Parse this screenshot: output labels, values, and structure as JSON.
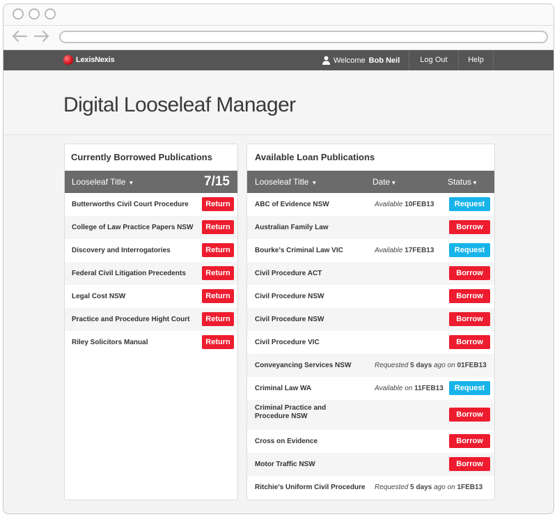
{
  "app": {
    "logo_text": "LexisNexis",
    "welcome_prefix": "Welcome",
    "user_name": "Bob Neil",
    "logout_label": "Log Out",
    "help_label": "Help",
    "page_title": "Digital Looseleaf Manager"
  },
  "colors": {
    "header_bg": "#555555",
    "table_header_bg": "#6b6b6b",
    "return_red": "#ed1c2e",
    "request_blue": "#17b4ea"
  },
  "borrowed": {
    "title": "Currently Borrowed Publications",
    "column_title": "Looseleaf Title",
    "count": "7/15",
    "button_label": "Return",
    "items": [
      "Butterworths Civil Court Procedure",
      "College of Law Practice Papers NSW",
      "Discovery and Interrogatories",
      "Federal Civil Litigation Precedents",
      "Legal Cost NSW",
      "Practice and Procedure Hight Court",
      "Riley Solicitors Manual"
    ]
  },
  "available": {
    "title": "Available Loan Publications",
    "columns": {
      "title": "Looseleaf Title",
      "date": "Date",
      "status": "Status"
    },
    "borrow_label": "Borrow",
    "request_label": "Request",
    "items": [
      {
        "name": "ABC of Evidence NSW",
        "status_pre": "Available",
        "status_mid": "",
        "status_bold": "10FEB13",
        "action": "Request"
      },
      {
        "name": "Australian Family Law",
        "status_pre": "",
        "status_mid": "",
        "status_bold": "",
        "action": "Borrow"
      },
      {
        "name": "Bourke's Criminal Law VIC",
        "status_pre": "Available",
        "status_mid": "",
        "status_bold": "17FEB13",
        "action": "Request"
      },
      {
        "name": "Civil Procedure ACT",
        "status_pre": "",
        "status_mid": "",
        "status_bold": "",
        "action": "Borrow"
      },
      {
        "name": "Civil Procedure NSW",
        "status_pre": "",
        "status_mid": "",
        "status_bold": "",
        "action": "Borrow"
      },
      {
        "name": "Civil Procedure NSW",
        "status_pre": "",
        "status_mid": "",
        "status_bold": "",
        "action": "Borrow"
      },
      {
        "name": "Civil Procedure VIC",
        "status_pre": "",
        "status_mid": "",
        "status_bold": "",
        "action": "Borrow"
      },
      {
        "name": "Conveyancing Services NSW",
        "status_pre": "Requested",
        "status_days": "5 days",
        "status_mid": "ago on",
        "status_bold": "01FEB13",
        "action": ""
      },
      {
        "name": "Criminal Law WA",
        "status_pre": "Available on",
        "status_mid": "",
        "status_bold": "11FEB13",
        "action": "Request"
      },
      {
        "name_line1": "Criminal Practice and",
        "name_line2": "Procedure NSW",
        "status_pre": "",
        "status_mid": "",
        "status_bold": "",
        "action": "Borrow"
      },
      {
        "name": "Cross on Evidence",
        "status_pre": "",
        "status_mid": "",
        "status_bold": "",
        "action": "Borrow"
      },
      {
        "name": "Motor Traffic NSW",
        "status_pre": "",
        "status_mid": "",
        "status_bold": "",
        "action": "Borrow"
      },
      {
        "name": "Ritchie's Uniform Civil Procedure",
        "status_pre": "Requested",
        "status_days": "5 days",
        "status_mid": "ago on",
        "status_bold": "1FEB13",
        "action": ""
      }
    ]
  }
}
